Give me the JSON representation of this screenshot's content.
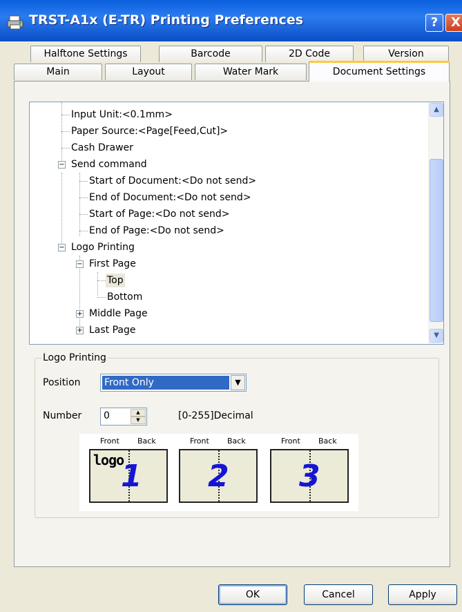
{
  "window": {
    "title": "TRST-A1x (E-TR) Printing Preferences",
    "help_label": "?",
    "close_label": "X"
  },
  "tabs": {
    "back_row": [
      "Halftone Settings",
      "Barcode",
      "2D Code",
      "Version"
    ],
    "front_row": [
      "Main",
      "Layout",
      "Water Mark",
      "Document Settings"
    ],
    "active": "Document Settings"
  },
  "tree": {
    "items": [
      {
        "label": "Input Unit:<0.1mm>",
        "level": 1
      },
      {
        "label": "Paper Source:<Page[Feed,Cut]>",
        "level": 1
      },
      {
        "label": "Cash Drawer",
        "level": 1
      },
      {
        "label": "Send command",
        "level": 1,
        "expander": "−"
      },
      {
        "label": "Start of Document:<Do not send>",
        "level": 2
      },
      {
        "label": "End of Document:<Do not send>",
        "level": 2
      },
      {
        "label": "Start of Page:<Do not send>",
        "level": 2
      },
      {
        "label": "End of Page:<Do not send>",
        "level": 2
      },
      {
        "label": "Logo Printing",
        "level": 1,
        "expander": "−"
      },
      {
        "label": "First Page",
        "level": 2,
        "expander": "−"
      },
      {
        "label": "Top",
        "level": 3,
        "selected": true
      },
      {
        "label": "Bottom",
        "level": 3
      },
      {
        "label": "Middle Page",
        "level": 2,
        "expander": "+"
      },
      {
        "label": "Last Page",
        "level": 2,
        "expander": "+"
      }
    ],
    "scroll_up": "▲",
    "scroll_down": "▼"
  },
  "logo_printing": {
    "group_title": "Logo Printing",
    "position_label": "Position",
    "position_value": "Front Only",
    "number_label": "Number",
    "number_value": "0",
    "number_hint": "[0-255]Decimal",
    "illustration": {
      "pages": [
        {
          "front": "Front",
          "back": "Back",
          "number": "1",
          "logo": "logo"
        },
        {
          "front": "Front",
          "back": "Back",
          "number": "2"
        },
        {
          "front": "Front",
          "back": "Back",
          "number": "3"
        }
      ]
    }
  },
  "buttons": {
    "ok": "OK",
    "cancel": "Cancel",
    "apply": "Apply"
  },
  "colors": {
    "titlebar": "#0a5fdd",
    "selection": "#316ac5",
    "page_number": "#1515d6",
    "active_tab_accent": "#ffc83c"
  }
}
